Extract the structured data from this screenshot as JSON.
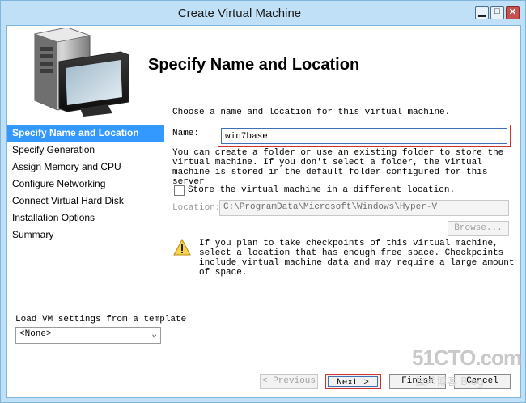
{
  "window": {
    "title": "Create Virtual Machine",
    "controls": {
      "minimize": "▁",
      "maximize": "□",
      "close": "✕"
    }
  },
  "header": {
    "title": "Specify Name and Location"
  },
  "sidebar": {
    "items": [
      {
        "label": "Specify Name and Location",
        "active": true
      },
      {
        "label": "Specify Generation",
        "active": false
      },
      {
        "label": "Assign Memory and CPU",
        "active": false
      },
      {
        "label": "Configure Networking",
        "active": false
      },
      {
        "label": "Connect Virtual Hard Disk",
        "active": false
      },
      {
        "label": "Installation Options",
        "active": false
      },
      {
        "label": "Summary",
        "active": false
      }
    ],
    "template_label": "Load VM settings from a template",
    "template_value": "<None>"
  },
  "main": {
    "intro": "Choose a name and location for this virtual machine.",
    "name_label": "Name:",
    "name_value": "win7base",
    "description": "You can create a folder or use an existing folder to store the virtual machine. If you don't select a folder, the virtual machine is stored in the default folder configured for this server",
    "store_checkbox_label": "Store the virtual machine in a different location.",
    "store_checked": false,
    "location_label": "Location:",
    "location_value": "C:\\ProgramData\\Microsoft\\Windows\\Hyper-V",
    "browse_label": "Browse...",
    "warning_text": "If you plan to take checkpoints of this virtual machine, select a location that has enough free space. Checkpoints include virtual machine data and may require a large amount of space."
  },
  "buttons": {
    "previous": "< Previous",
    "next": "Next >",
    "finish": "Finish",
    "cancel": "Cancel"
  },
  "watermark": {
    "main": "51CTO.com",
    "sub": "技术博客   Blog"
  },
  "colors": {
    "accent": "#3399ff",
    "highlight_box": "#cc3333",
    "frame": "#bfe0f6"
  }
}
